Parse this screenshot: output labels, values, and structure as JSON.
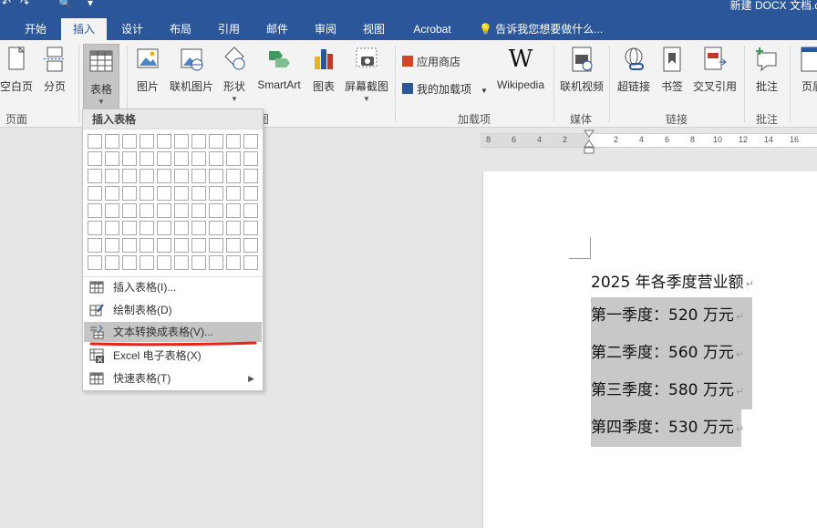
{
  "window": {
    "title": "新建 DOCX 文档.d",
    "quick_access": [
      "↶",
      "↷",
      "🔍",
      "▾"
    ]
  },
  "tabs": [
    {
      "label": "开始",
      "active": false
    },
    {
      "label": "插入",
      "active": true
    },
    {
      "label": "设计",
      "active": false
    },
    {
      "label": "布局",
      "active": false
    },
    {
      "label": "引用",
      "active": false
    },
    {
      "label": "邮件",
      "active": false
    },
    {
      "label": "审阅",
      "active": false
    },
    {
      "label": "视图",
      "active": false
    },
    {
      "label": "Acrobat",
      "active": false
    }
  ],
  "tell_me": "告诉我您想要做什么...",
  "ribbon": {
    "pages": {
      "blank_page": "空白页",
      "page_break": "分页",
      "group": "页面"
    },
    "tables": {
      "table": "表格"
    },
    "illustrations": {
      "picture": "图片",
      "online_picture": "联机图片",
      "shapes": "形状",
      "smartart": "SmartArt",
      "chart": "图表",
      "screenshot": "屏幕截图",
      "group": "图"
    },
    "addins": {
      "store": "应用商店",
      "my_addins": "我的加载项",
      "wikipedia": "Wikipedia",
      "group": "加载项"
    },
    "media": {
      "online_video": "联机视频",
      "group": "媒体"
    },
    "links": {
      "hyperlink": "超链接",
      "bookmark": "书签",
      "cross_ref": "交叉引用",
      "group": "链接"
    },
    "comments": {
      "comment": "批注",
      "group": "批注"
    },
    "header_footer": {
      "header": "页眉"
    }
  },
  "ruler": {
    "ticks": [
      "8",
      "6",
      "4",
      "2",
      "2",
      "4",
      "6",
      "8",
      "10",
      "12",
      "14",
      "16"
    ]
  },
  "document": {
    "lines": [
      {
        "text": "2025 年各季度营业额",
        "selected": false
      },
      {
        "text": "第一季度：520 万元",
        "selected": true
      },
      {
        "text": "第二季度：560 万元",
        "selected": true
      },
      {
        "text": "第三季度：580 万元",
        "selected": true
      },
      {
        "text": "第四季度：530 万元",
        "selected": true
      }
    ],
    "para_mark": "↵"
  },
  "dropdown": {
    "header": "插入表格",
    "grid": {
      "cols": 10,
      "rows": 8
    },
    "items": [
      {
        "label": "插入表格(I)...",
        "icon": "table-grid-icon",
        "highlighted": false
      },
      {
        "label": "绘制表格(D)",
        "icon": "draw-table-icon",
        "highlighted": false
      },
      {
        "label": "文本转换成表格(V)...",
        "icon": "text-to-table-icon",
        "highlighted": true
      },
      {
        "label": "Excel 电子表格(X)",
        "icon": "excel-sheet-icon",
        "highlighted": false
      },
      {
        "label": "快速表格(T)",
        "icon": "quick-table-icon",
        "highlighted": false,
        "submenu": true
      }
    ]
  },
  "colors": {
    "accent": "#2b579a",
    "highlight": "#c5c5c5",
    "annotation": "#e8231a"
  }
}
